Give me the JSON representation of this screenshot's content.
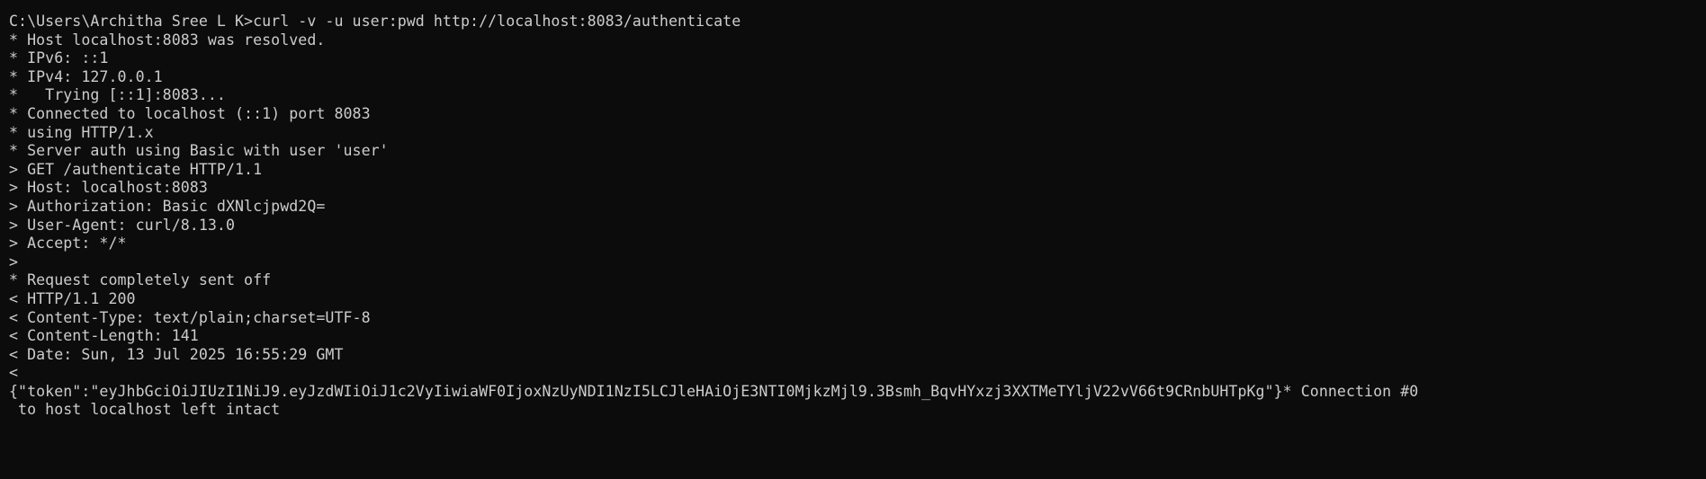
{
  "terminal": {
    "lines": [
      "C:\\Users\\Architha Sree L K>curl -v -u user:pwd http://localhost:8083/authenticate",
      "* Host localhost:8083 was resolved.",
      "* IPv6: ::1",
      "* IPv4: 127.0.0.1",
      "*   Trying [::1]:8083...",
      "* Connected to localhost (::1) port 8083",
      "* using HTTP/1.x",
      "* Server auth using Basic with user 'user'",
      "> GET /authenticate HTTP/1.1",
      "> Host: localhost:8083",
      "> Authorization: Basic dXNlcjpwd2Q=",
      "> User-Agent: curl/8.13.0",
      "> Accept: */*",
      ">",
      "* Request completely sent off",
      "< HTTP/1.1 200",
      "< Content-Type: text/plain;charset=UTF-8",
      "< Content-Length: 141",
      "< Date: Sun, 13 Jul 2025 16:55:29 GMT",
      "<",
      "{\"token\":\"eyJhbGciOiJIUzI1NiJ9.eyJzdWIiOiJ1c2VyIiwiaWF0IjoxNzUyNDI1NzI5LCJleHAiOjE3NTI0MjkzMjl9.3Bsmh_BqvHYxzj3XXTMeTYljV22vV66t9CRnbUHTpKg\"}* Connection #0",
      " to host localhost left intact"
    ]
  }
}
